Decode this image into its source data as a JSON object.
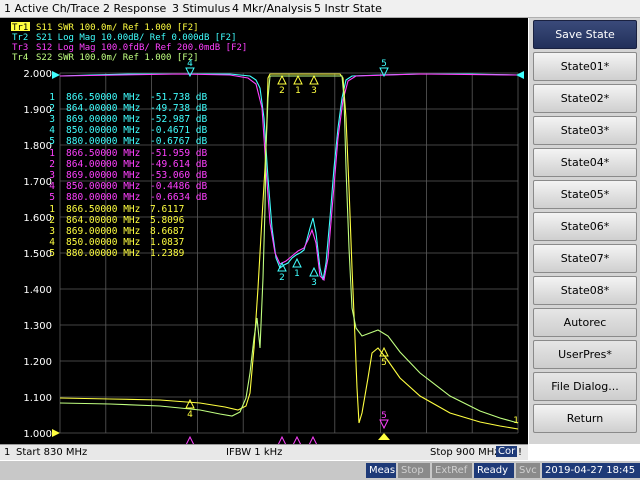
{
  "menu": [
    "1 Active Ch/Trace",
    "2 Response",
    "3 Stimulus",
    "4 Mkr/Analysis",
    "5 Instr State"
  ],
  "traces_header": [
    {
      "tag": "Tr1",
      "text": "S11  SWR 100.0m/ Ref 1.000  [F2]",
      "color": "#ffff40",
      "active": true
    },
    {
      "tag": "Tr2",
      "text": "S21  Log Mag 10.00dB/ Ref 0.000dB  [F2]",
      "color": "#40ffff",
      "active": false
    },
    {
      "tag": "Tr3",
      "text": "S12  Log Mag 100.0fdB/ Ref 200.0mdB  [F2]",
      "color": "#ff40ff",
      "active": false
    },
    {
      "tag": "Tr4",
      "text": "S22  SWR 100.0m/ Ref 1.000  [F2]",
      "color": "#c0ff80",
      "active": false
    }
  ],
  "y_ticks": [
    "2.000",
    "1.900",
    "1.800",
    "1.700",
    "1.600",
    "1.500",
    "1.400",
    "1.300",
    "1.200",
    "1.100",
    "1.000"
  ],
  "marker_tables": [
    {
      "color": "#40ffff",
      "rows": [
        [
          "1",
          "866.50000 MHz",
          "-51.738 dB"
        ],
        [
          "2",
          "864.00000 MHz",
          "-49.738 dB"
        ],
        [
          "3",
          "869.00000 MHz",
          "-52.987 dB"
        ],
        [
          "4",
          "850.00000 MHz",
          "-0.4671 dB"
        ],
        [
          "5",
          "880.00000 MHz",
          "-0.6767 dB"
        ]
      ]
    },
    {
      "color": "#ff40ff",
      "rows": [
        [
          "1",
          "866.50000 MHz",
          "-51.959 dB"
        ],
        [
          "2",
          "864.00000 MHz",
          "-49.614 dB"
        ],
        [
          "3",
          "869.00000 MHz",
          "-53.060 dB"
        ],
        [
          "4",
          "850.00000 MHz",
          "-0.4486 dB"
        ],
        [
          "5",
          "880.00000 MHz",
          "-0.6634 dB"
        ]
      ]
    },
    {
      "color": "#ffff40",
      "rows": [
        [
          "1",
          "866.50000 MHz",
          "7.6117"
        ],
        [
          "2",
          "864.00000 MHz",
          "5.8096"
        ],
        [
          "3",
          "869.00000 MHz",
          "8.6687"
        ],
        [
          "4",
          "850.00000 MHz",
          "1.0837"
        ],
        [
          "5",
          "880.00000 MHz",
          "1.2389"
        ]
      ]
    }
  ],
  "marker_labels": [
    "1",
    "2",
    "3",
    "4",
    "5"
  ],
  "ref_marker_labels": [
    "1",
    "1"
  ],
  "softkeys": [
    {
      "label": "Save State",
      "style": "active"
    },
    {
      "label": "State01*",
      "style": "normal"
    },
    {
      "label": "State02*",
      "style": "normal"
    },
    {
      "label": "State03*",
      "style": "normal"
    },
    {
      "label": "State04*",
      "style": "normal"
    },
    {
      "label": "State05*",
      "style": "normal"
    },
    {
      "label": "State06*",
      "style": "normal"
    },
    {
      "label": "State07*",
      "style": "normal"
    },
    {
      "label": "State08*",
      "style": "normal"
    },
    {
      "label": "Autorec",
      "style": "disabled"
    },
    {
      "label": "UserPres*",
      "style": "disabled"
    },
    {
      "label": "File Dialog...",
      "style": "disabled"
    },
    {
      "label": "Return",
      "style": "normal"
    }
  ],
  "bottom": {
    "channel": "1",
    "start": "Start 830 MHz",
    "ifbw": "IFBW 1 kHz",
    "stop": "Stop 900 MHz",
    "cor": "Cor",
    "excl": "!"
  },
  "status": {
    "meas": "Meas",
    "stop": "Stop",
    "extref": "ExtRef",
    "ready": "Ready",
    "svc": "Svc",
    "datetime": "2019-04-27 18:45"
  },
  "colors": {
    "tr1": "#ffff40",
    "tr2": "#40ffff",
    "tr3": "#ff40ff",
    "tr4": "#c0ff80",
    "grid": "#6a6a6a",
    "background": "#000000"
  }
}
